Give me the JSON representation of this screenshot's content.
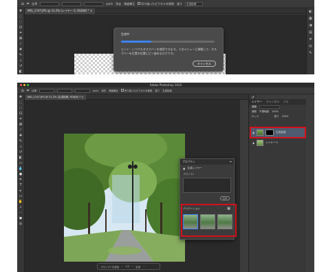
{
  "top_screenshot": {
    "toolbar": {
      "home_icon": "home-icon",
      "crop_icon": "crop-icon",
      "ratio_label": "比率",
      "unit_value": "px/in",
      "clear_label": "消去",
      "straighten_label": "角度補正",
      "delete_cropped_label": "切り抜いたピクセルを削除",
      "fill_label": "塗り",
      "generative_expand_label": "生成拡張"
    },
    "document_tab": "IMG_1747.JPG @ 31.2% (レイヤー 0, RGB/8) *",
    "dialog": {
      "title": "生成中",
      "progress": 0.32,
      "hint": "ヒント：いつでもタスクバーを使用できます。３点メニューに移動して、タスクバーを位置の位置にピン留めるだけです。",
      "cancel_label": "キャンセル"
    }
  },
  "bottom_screenshot": {
    "window_title": "Adobe Photoshop 2024",
    "share_label": "共有",
    "toolbar": {
      "ratio_label": "比率",
      "unit_value": "px/in",
      "clear_label": "消去",
      "straighten_label": "角度補正",
      "delete_cropped_label": "切り抜いたピクセルを削除",
      "fill_label": "塗り",
      "generative_expand_label": "生成拡張"
    },
    "document_tab": "IMG_1747.JPG @ 31.2% (生成拡張, RGB/8) *",
    "layers_panel": {
      "tabs": [
        "レイヤー",
        "チャンネル",
        "パス"
      ],
      "kind_label": "種類",
      "blend_mode": "通常",
      "opacity_label": "不透明度",
      "opacity_value": "100%",
      "lock_label": "ロック",
      "fill_label": "塗り",
      "fill_value": "100%",
      "layers": [
        {
          "name": "生成拡張",
          "selected": true
        },
        {
          "name": "レイヤー 0",
          "selected": false
        }
      ]
    },
    "properties_panel": {
      "title": "プロパティ",
      "layer_type": "生成レイヤー",
      "prompt_label": "プロンプト",
      "generate_label": "生成",
      "variations_label": "バリエーション",
      "variation_count": 3
    },
    "context_bar": {
      "prompt_placeholder": "プロンプトを追加",
      "page": "1/3",
      "generate_label": "生成"
    },
    "colors": {
      "highlight": "#d4101a",
      "accent": "#2f6fe0"
    }
  }
}
